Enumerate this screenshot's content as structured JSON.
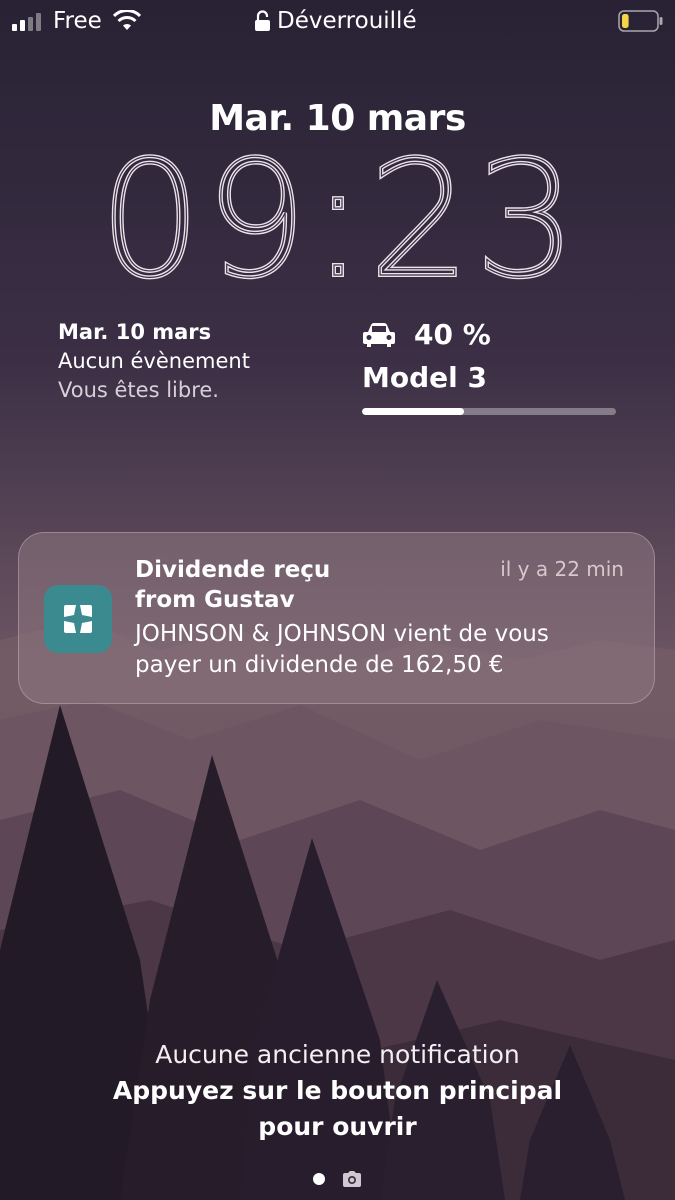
{
  "status_bar": {
    "carrier": "Free",
    "lock_label": "Déverrouillé",
    "signal_bars": 2,
    "battery_level": 0.2
  },
  "lock_screen": {
    "date": "Mar. 10 mars",
    "time": "09:23"
  },
  "widgets": {
    "calendar": {
      "date": "Mar. 10 mars",
      "event": "Aucun évènement",
      "subtext": "Vous êtes libre."
    },
    "car": {
      "icon": "car-icon",
      "charge": "40 %",
      "charge_level": 0.4,
      "model": "Model 3"
    }
  },
  "notification": {
    "app_icon": "gustav-app-icon",
    "title_line1": "Dividende reçu",
    "title_line2": "from Gustav",
    "time": "il y a 22 min",
    "body_line1": "JOHNSON & JOHNSON vient de vous",
    "body_line2": "payer un dividende de 162,50 €"
  },
  "footer": {
    "no_older": "Aucune ancienne notification",
    "press_line1": "Appuyez sur le bouton principal",
    "press_line2": "pour ouvrir"
  },
  "colors": {
    "app_icon_bg": "#3b8a8f",
    "sky_top": "#2a2236",
    "mountain": "#6e5965"
  }
}
